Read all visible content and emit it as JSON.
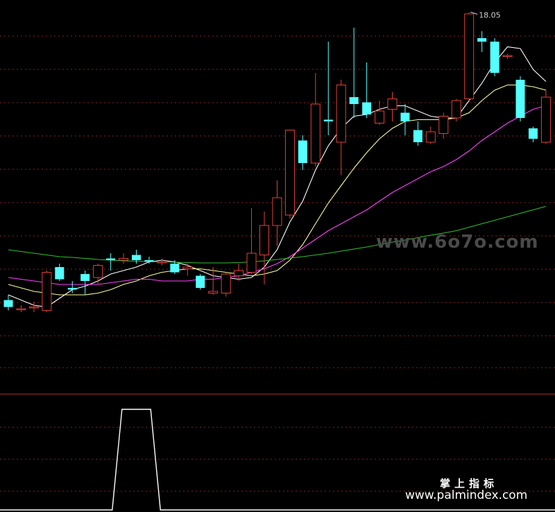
{
  "colors": {
    "background": "#000000",
    "grid": "#8a2020",
    "up_candle": "#e0403c",
    "down_candle": "#54ffff",
    "ma5": "#ffffff",
    "ma10": "#ffff99",
    "ma20": "#ff40ff",
    "ma60": "#30c030",
    "indicator_line": "#ffffff",
    "panel_divider": "#b03030"
  },
  "watermarks": {
    "site_gray": "www.6o7o.com",
    "brand_cn": "掌上指标",
    "site_white": "www.palmindex.com"
  },
  "chart_data": [
    {
      "type": "candlestick",
      "title": "",
      "highest_label": "18.05",
      "ylim": [
        8.0,
        18.3
      ],
      "grid": true,
      "candles": [
        {
          "o": 9.75,
          "h": 9.9,
          "l": 9.45,
          "c": 9.55
        },
        {
          "o": 9.5,
          "h": 9.6,
          "l": 9.4,
          "c": 9.5
        },
        {
          "o": 9.55,
          "h": 9.7,
          "l": 9.4,
          "c": 9.55
        },
        {
          "o": 9.45,
          "h": 10.6,
          "l": 9.4,
          "c": 10.55
        },
        {
          "o": 10.7,
          "h": 10.8,
          "l": 10.3,
          "c": 10.35
        },
        {
          "o": 10.1,
          "h": 10.3,
          "l": 9.95,
          "c": 10.05
        },
        {
          "o": 10.5,
          "h": 10.6,
          "l": 9.9,
          "c": 10.3
        },
        {
          "o": 10.4,
          "h": 10.8,
          "l": 10.2,
          "c": 10.75
        },
        {
          "o": 10.95,
          "h": 11.1,
          "l": 10.6,
          "c": 10.9
        },
        {
          "o": 10.9,
          "h": 11.1,
          "l": 10.8,
          "c": 10.95
        },
        {
          "o": 11.05,
          "h": 11.2,
          "l": 10.8,
          "c": 10.9
        },
        {
          "o": 10.9,
          "h": 11.0,
          "l": 10.8,
          "c": 10.85
        },
        {
          "o": 10.85,
          "h": 10.95,
          "l": 10.75,
          "c": 10.85
        },
        {
          "o": 10.8,
          "h": 10.9,
          "l": 10.5,
          "c": 10.55
        },
        {
          "o": 10.65,
          "h": 10.8,
          "l": 10.45,
          "c": 10.7
        },
        {
          "o": 10.45,
          "h": 10.5,
          "l": 10.05,
          "c": 10.1
        },
        {
          "o": 9.95,
          "h": 10.7,
          "l": 9.9,
          "c": 10.0
        },
        {
          "o": 9.95,
          "h": 10.55,
          "l": 9.85,
          "c": 10.5
        },
        {
          "o": 10.45,
          "h": 10.8,
          "l": 10.3,
          "c": 10.6
        },
        {
          "o": 10.55,
          "h": 12.4,
          "l": 10.5,
          "c": 11.1
        },
        {
          "o": 11.05,
          "h": 12.3,
          "l": 10.2,
          "c": 11.9
        },
        {
          "o": 11.9,
          "h": 13.2,
          "l": 11.3,
          "c": 12.7
        },
        {
          "o": 12.2,
          "h": 14.65,
          "l": 12.1,
          "c": 14.65
        },
        {
          "o": 14.35,
          "h": 14.5,
          "l": 13.5,
          "c": 13.7
        },
        {
          "o": 13.7,
          "h": 16.3,
          "l": 13.6,
          "c": 15.4
        },
        {
          "o": 14.95,
          "h": 17.2,
          "l": 14.5,
          "c": 14.9
        },
        {
          "o": 14.3,
          "h": 16.1,
          "l": 13.35,
          "c": 15.95
        },
        {
          "o": 15.6,
          "h": 17.6,
          "l": 15.0,
          "c": 15.4
        },
        {
          "o": 15.45,
          "h": 16.6,
          "l": 15.0,
          "c": 15.1
        },
        {
          "o": 14.85,
          "h": 15.5,
          "l": 14.8,
          "c": 15.2
        },
        {
          "o": 15.25,
          "h": 15.75,
          "l": 14.9,
          "c": 15.55
        },
        {
          "o": 15.15,
          "h": 15.4,
          "l": 14.5,
          "c": 14.9
        },
        {
          "o": 14.65,
          "h": 14.9,
          "l": 14.2,
          "c": 14.3
        },
        {
          "o": 14.3,
          "h": 14.75,
          "l": 14.25,
          "c": 14.6
        },
        {
          "o": 14.55,
          "h": 15.15,
          "l": 14.4,
          "c": 15.05
        },
        {
          "o": 15.0,
          "h": 15.55,
          "l": 14.9,
          "c": 15.5
        },
        {
          "o": 15.55,
          "h": 18.05,
          "l": 15.45,
          "c": 18.0
        },
        {
          "o": 17.3,
          "h": 17.5,
          "l": 16.9,
          "c": 17.2
        },
        {
          "o": 17.2,
          "h": 17.3,
          "l": 16.2,
          "c": 16.3
        },
        {
          "o": 16.8,
          "h": 16.85,
          "l": 16.7,
          "c": 16.8
        },
        {
          "o": 16.1,
          "h": 16.2,
          "l": 14.9,
          "c": 15.0
        },
        {
          "o": 14.7,
          "h": 14.75,
          "l": 14.3,
          "c": 14.4
        },
        {
          "o": 14.3,
          "h": 15.8,
          "l": 14.25,
          "c": 15.6
        }
      ],
      "moving_averages": [
        {
          "key": "ma5",
          "values": [
            9.9,
            9.75,
            9.6,
            9.55,
            9.8,
            10.05,
            10.15,
            10.3,
            10.5,
            10.6,
            10.7,
            10.85,
            10.9,
            10.85,
            10.75,
            10.6,
            10.45,
            10.4,
            10.35,
            10.4,
            10.7,
            11.2,
            12.0,
            12.6,
            13.5,
            14.2,
            14.7,
            15.05,
            15.1,
            15.25,
            15.35,
            15.35,
            15.2,
            15.05,
            15.0,
            15.0,
            15.5,
            16.0,
            16.6,
            17.05,
            17.0,
            16.4,
            16.05
          ]
        },
        {
          "key": "ma10",
          "values": [
            10.2,
            10.1,
            10.0,
            9.95,
            9.9,
            9.9,
            9.9,
            9.95,
            10.05,
            10.2,
            10.3,
            10.45,
            10.55,
            10.6,
            10.65,
            10.65,
            10.6,
            10.55,
            10.5,
            10.45,
            10.5,
            10.6,
            10.9,
            11.35,
            11.95,
            12.55,
            13.05,
            13.55,
            14.0,
            14.4,
            14.7,
            14.9,
            14.95,
            14.95,
            14.95,
            15.0,
            15.15,
            15.5,
            15.8,
            15.95,
            15.95,
            15.9,
            15.8
          ]
        },
        {
          "key": "ma20",
          "values": [
            10.4,
            10.35,
            10.3,
            10.25,
            10.2,
            10.2,
            10.2,
            10.2,
            10.25,
            10.3,
            10.35,
            10.35,
            10.3,
            10.3,
            10.3,
            10.35,
            10.35,
            10.4,
            10.45,
            10.55,
            10.65,
            10.8,
            11.0,
            11.25,
            11.5,
            11.75,
            11.95,
            12.15,
            12.35,
            12.6,
            12.85,
            13.05,
            13.25,
            13.45,
            13.6,
            13.8,
            14.05,
            14.35,
            14.6,
            14.85,
            15.05,
            15.25,
            15.35
          ]
        },
        {
          "key": "ma60",
          "values": [
            11.2,
            11.15,
            11.1,
            11.05,
            11.0,
            10.98,
            10.95,
            10.92,
            10.9,
            10.88,
            10.87,
            10.86,
            10.85,
            10.84,
            10.83,
            10.82,
            10.82,
            10.82,
            10.83,
            10.85,
            10.88,
            10.92,
            10.96,
            11.0,
            11.05,
            11.1,
            11.16,
            11.22,
            11.28,
            11.35,
            11.42,
            11.48,
            11.55,
            11.62,
            11.68,
            11.75,
            11.85,
            11.95,
            12.05,
            12.15,
            12.25,
            12.35,
            12.45
          ]
        }
      ]
    },
    {
      "type": "line",
      "title": "",
      "ylim": [
        0,
        1
      ],
      "grid": true,
      "values": [
        0,
        0,
        0,
        0,
        0,
        0,
        0,
        0,
        0,
        1,
        1,
        1,
        0,
        0,
        0,
        0,
        0,
        0,
        0,
        0,
        0,
        0,
        0,
        0,
        0,
        0,
        0,
        0,
        0,
        0,
        0,
        0,
        0,
        0,
        0,
        0,
        0,
        0,
        0,
        0,
        0,
        0,
        0
      ]
    }
  ]
}
